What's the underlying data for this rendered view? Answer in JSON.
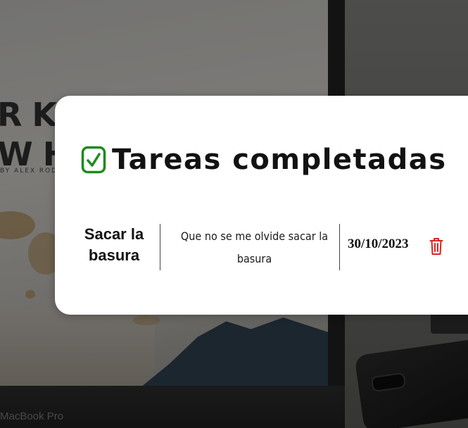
{
  "background": {
    "cover_letters_line1": "RKH",
    "cover_letters_line2": "WH",
    "cover_byline": "BY ALEX RODR",
    "device_label": "MacBook Pro"
  },
  "panel": {
    "title": "Tareas completadas",
    "title_icon": "checkbox-checked-icon",
    "accent_color": "#1f8a1f"
  },
  "tasks": [
    {
      "name": "Sacar la basura",
      "description": "Que no se me olvide sacar la basura",
      "date": "30/10/2023",
      "delete_icon": "trash-icon",
      "delete_color": "#e02020"
    }
  ]
}
